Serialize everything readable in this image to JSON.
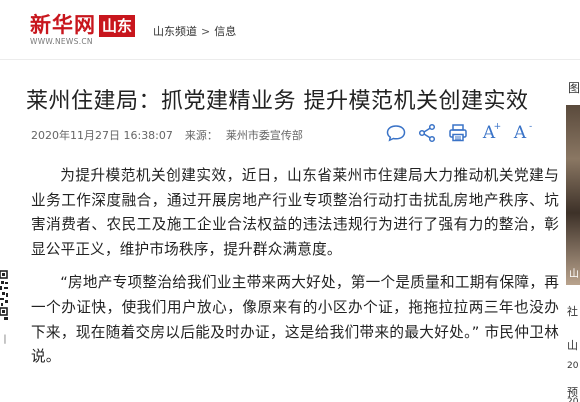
{
  "header": {
    "logo_text": "新华网",
    "logo_url": "WWW.NEWS.CN",
    "logo_region": "山东",
    "breadcrumb": [
      "山东频道",
      "信息"
    ],
    "breadcrumb_sep": ">"
  },
  "article": {
    "title": "莱州住建局：抓党建精业务 提升模范机关创建实效",
    "date": "2020年11月27日 16:38:07",
    "source_label": "来源：",
    "source": "莱州市委宣传部",
    "paragraphs": [
      "为提升模范机关创建实效，近日，山东省莱州市住建局大力推动机关党建与业务工作深度融合，通过开展房地产行业专项整治行动打击扰乱房地产秩序、坑害消费者、农民工及施工企业合法权益的违法违规行为进行了强有力的整治，彰显公平正义，维护市场秩序，提升群众满意度。",
      "“房地产专项整治给我们业主带来两大好处，第一个是质量和工期有保障，再一个办证快，使我们用户放心，像原来有的小区办个证，拖拖拉拉两三年也没办下来，现在随着交房以后能及时办证，这是给我们带来的最大好处。” 市民仲卫林说。"
    ]
  },
  "tools": {
    "comment": "comment-icon",
    "share": "share-icon",
    "print": "print-icon",
    "font_up_label": "A",
    "font_up_sign": "+",
    "font_down_label": "A",
    "font_down_sign": "-"
  },
  "right_rail": {
    "head": "图",
    "image_caption": "山",
    "item1": "社",
    "item2": "山",
    "item3": "20",
    "item4": "预",
    "item5": "20"
  },
  "qr": {
    "label": "丨"
  },
  "colors": {
    "brand_red": "#c8161d",
    "tool_blue": "#3a73c7",
    "text": "#222222"
  }
}
